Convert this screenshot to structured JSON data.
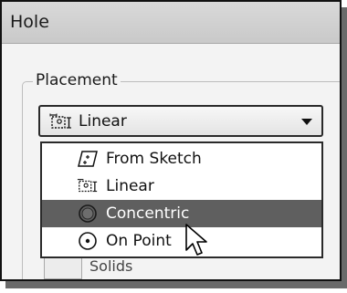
{
  "window": {
    "title": "Hole"
  },
  "placement": {
    "group_label": "Placement",
    "selected_value": "Linear",
    "selected_icon": "linear-placement-icon",
    "options": [
      {
        "label": "From Sketch",
        "icon": "from-sketch-icon"
      },
      {
        "label": "Linear",
        "icon": "linear-placement-icon"
      },
      {
        "label": "Concentric",
        "icon": "concentric-icon",
        "highlighted": true
      },
      {
        "label": "On Point",
        "icon": "on-point-icon"
      }
    ]
  },
  "partial_below": {
    "label": "Solids"
  },
  "colors": {
    "highlight": "#5f5f5f",
    "dialog_bg": "#f3f3f3"
  }
}
